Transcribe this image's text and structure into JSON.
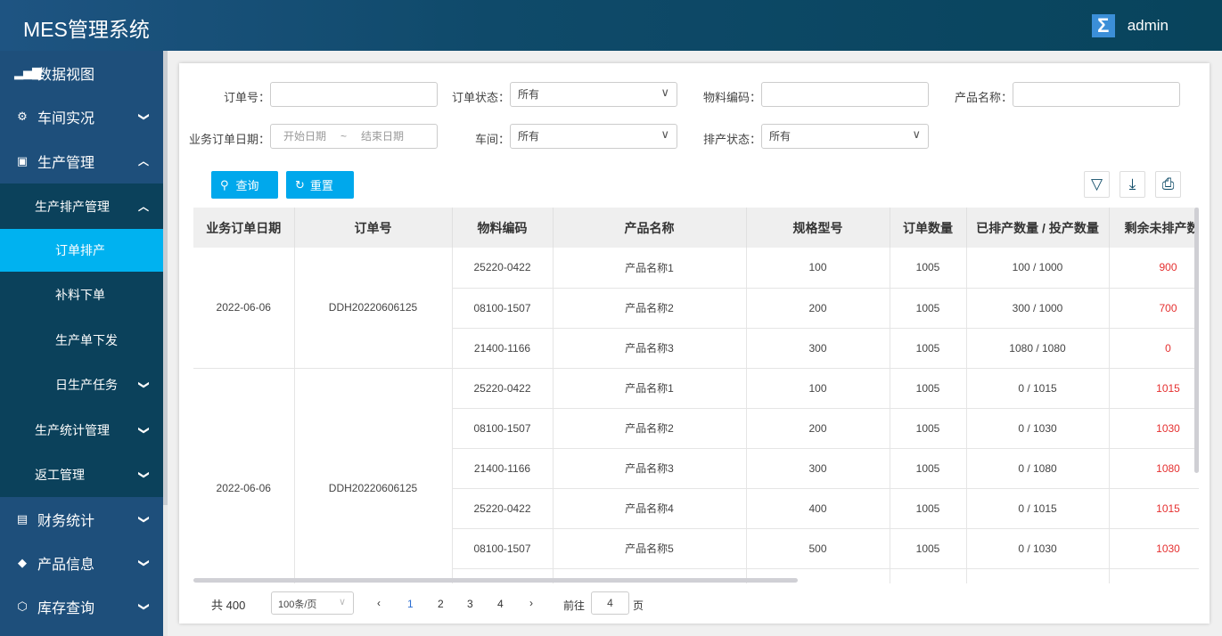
{
  "header": {
    "title": "MES管理系统",
    "user": "admin",
    "logo_icon": "sigma-icon"
  },
  "sidebar": {
    "items": [
      {
        "label": "数据视图",
        "icon": "bar-chart-icon"
      },
      {
        "label": "车间实况",
        "icon": "robot-arm-icon"
      },
      {
        "label": "生产管理",
        "icon": "production-icon"
      },
      {
        "label": "生产排产管理"
      },
      {
        "label": "订单排产",
        "active": true
      },
      {
        "label": "补料下单"
      },
      {
        "label": "生产单下发"
      },
      {
        "label": "日生产任务"
      },
      {
        "label": "生产统计管理"
      },
      {
        "label": "返工管理"
      },
      {
        "label": "财务统计",
        "icon": "document-icon"
      },
      {
        "label": "产品信息",
        "icon": "cube-icon"
      },
      {
        "label": "库存查询",
        "icon": "box-icon"
      }
    ]
  },
  "filters": {
    "order_no": {
      "label": "订单号：",
      "value": ""
    },
    "order_status": {
      "label": "订单状态：",
      "value": "所有"
    },
    "material_code": {
      "label": "物料编码：",
      "value": ""
    },
    "product_name": {
      "label": "产品名称：",
      "value": ""
    },
    "order_date": {
      "label": "业务订单日期：",
      "start": "开始日期",
      "sep": "~",
      "end": "结束日期"
    },
    "workshop": {
      "label": "车间：",
      "value": "所有"
    },
    "schedule_status": {
      "label": "排产状态：",
      "value": "所有"
    }
  },
  "buttons": {
    "query": "查询",
    "reset": "重置"
  },
  "table": {
    "columns": [
      "业务订单日期",
      "订单号",
      "物料编码",
      "产品名称",
      "规格型号",
      "订单数量",
      "已排产数量 / 投产数量",
      "剩余未排产数量"
    ],
    "groups": [
      {
        "date": "2022-06-06",
        "order": "DDH20220606125",
        "rows": [
          [
            "25220-0422",
            "产品名称1",
            "100",
            "1005",
            "100 / 1000",
            "900"
          ],
          [
            "08100-1507",
            "产品名称2",
            "200",
            "1005",
            "300 / 1000",
            "700"
          ],
          [
            "21400-1166",
            "产品名称3",
            "300",
            "1005",
            "1080 / 1080",
            "0"
          ]
        ]
      },
      {
        "date": "2022-06-06",
        "order": "DDH20220606125",
        "rows": [
          [
            "25220-0422",
            "产品名称1",
            "100",
            "1005",
            "0 / 1015",
            "1015"
          ],
          [
            "08100-1507",
            "产品名称2",
            "200",
            "1005",
            "0 / 1030",
            "1030"
          ],
          [
            "21400-1166",
            "产品名称3",
            "300",
            "1005",
            "0 / 1080",
            "1080"
          ],
          [
            "25220-0422",
            "产品名称4",
            "400",
            "1005",
            "0 / 1015",
            "1015"
          ],
          [
            "08100-1507",
            "产品名称5",
            "500",
            "1005",
            "0 / 1030",
            "1030"
          ]
        ]
      }
    ]
  },
  "pagination": {
    "total": "共 400",
    "page_size": "100条/页",
    "pages": [
      "1",
      "2",
      "3",
      "4"
    ],
    "current": "1",
    "goto_label": "前往",
    "goto_value": "4",
    "goto_suffix": "页"
  },
  "colors": {
    "accent": "#00b2f0",
    "remaining": "#e53030",
    "sidebar": "#1e4f7b"
  }
}
